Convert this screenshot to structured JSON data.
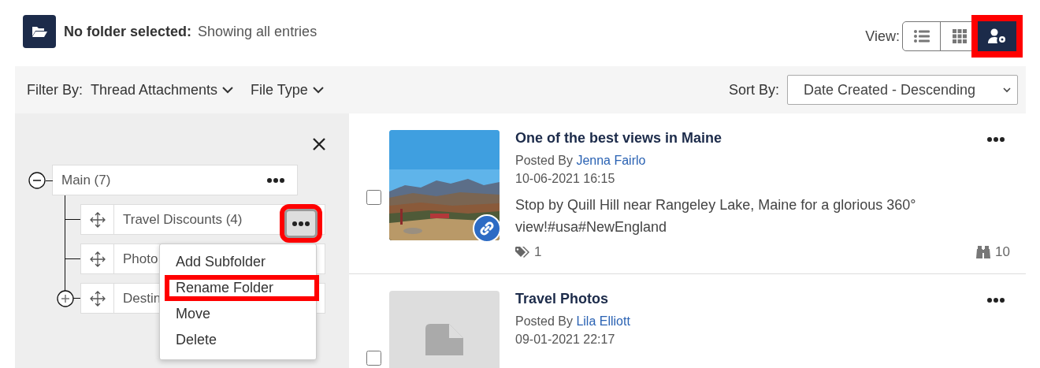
{
  "header": {
    "label": "No folder selected:",
    "text": "Showing all entries"
  },
  "view": {
    "label": "View:",
    "buttons": [
      {
        "kind": "list",
        "selected": false,
        "highlighted": false
      },
      {
        "kind": "grid",
        "selected": false,
        "highlighted": false
      },
      {
        "kind": "user-settings",
        "selected": true,
        "highlighted": true
      }
    ]
  },
  "filter": {
    "label": "Filter By:",
    "dropdowns": [
      "Thread Attachments",
      "File Type"
    ]
  },
  "sort": {
    "label": "Sort By:",
    "value": "Date Created - Descending"
  },
  "folder_tree": [
    {
      "name": "Main (7)",
      "expanded": true,
      "children": [
        {
          "name": "Travel Discounts (4)",
          "kind": "leaf",
          "more_button_highlighted": true,
          "menu": [
            {
              "label": "Add Subfolder",
              "highlighted": false
            },
            {
              "label": "Rename Folder",
              "highlighted": true
            },
            {
              "label": "Move",
              "highlighted": false
            },
            {
              "label": "Delete",
              "highlighted": false
            }
          ]
        },
        {
          "name": "Photo",
          "kind": "leaf"
        },
        {
          "name": "Destin",
          "kind": "collapsed"
        }
      ]
    }
  ],
  "entries": [
    {
      "kind": "picture",
      "link_badge": true,
      "checked": false,
      "title": "One of the best views in Maine",
      "posted_by": "Posted By",
      "author": "Jenna Fairlo",
      "date": "10-06-2021 16:15",
      "text": "Stop by Quill Hill near Rangeley Lake, Maine for a glorious 360° view!#usa#NewEngland",
      "tags": "1",
      "views": "10"
    },
    {
      "kind": "document",
      "checked": false,
      "title": "Travel Photos",
      "posted_by": "Posted By",
      "author": "Lila Elliott",
      "date": "09-01-2021 22:17"
    }
  ]
}
